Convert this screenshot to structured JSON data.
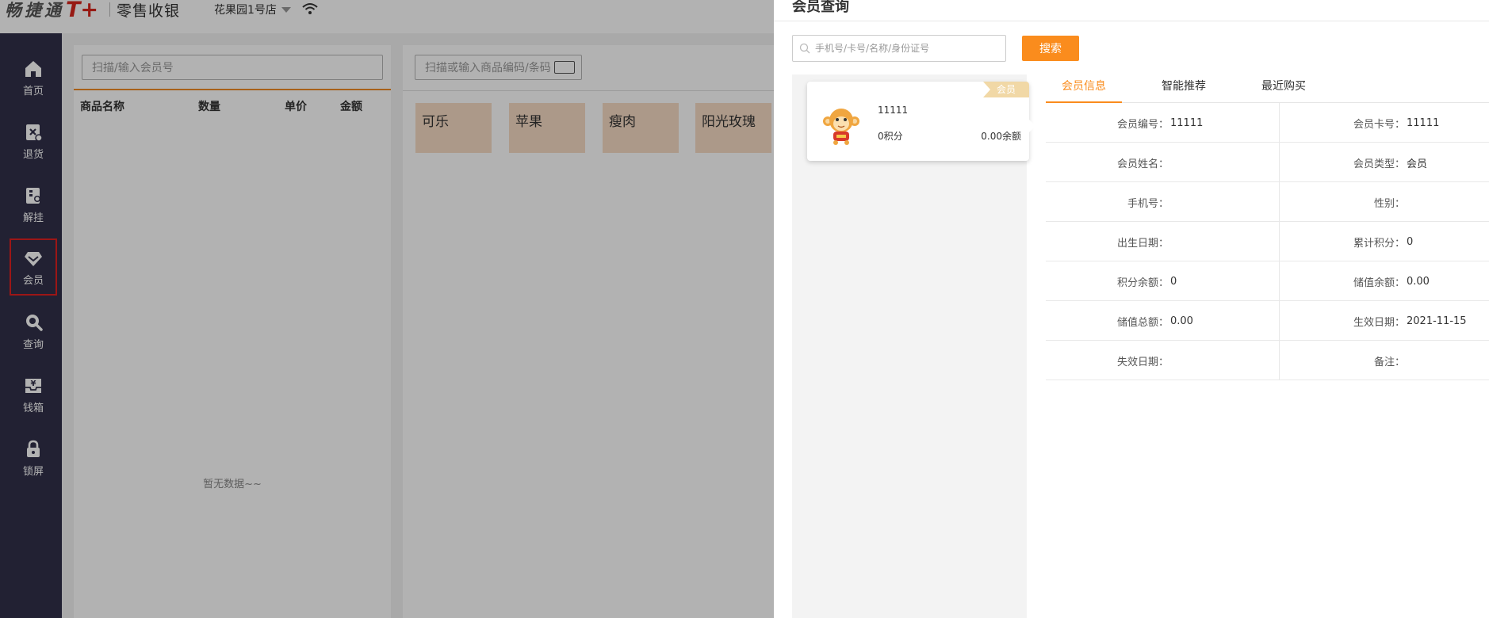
{
  "pos": {
    "logo_text": "畅捷通",
    "logo_mark": "T+",
    "app_name": "零售收银",
    "store_name": "花果园1号店",
    "nav": [
      {
        "label": "首页",
        "icon": "home-icon"
      },
      {
        "label": "退货",
        "icon": "return-icon"
      },
      {
        "label": "解挂",
        "icon": "unhold-icon"
      },
      {
        "label": "会员",
        "icon": "diamond-icon"
      },
      {
        "label": "查询",
        "icon": "search-icon"
      },
      {
        "label": "钱箱",
        "icon": "cash-box-icon"
      },
      {
        "label": "锁屏",
        "icon": "lock-icon"
      }
    ],
    "active_nav": "会员",
    "member_input_placeholder": "扫描/输入会员号",
    "cart_columns": [
      "商品名称",
      "数量",
      "单价",
      "金额"
    ],
    "empty_text": "暂无数据~~",
    "goods_input_placeholder": "扫描或输入商品编码/条码",
    "goods": [
      "可乐",
      "苹果",
      "瘦肉",
      "阳光玫瑰"
    ]
  },
  "drawer": {
    "title": "会员查询",
    "search_placeholder": "手机号/卡号/名称/身份证号",
    "search_label": "搜索",
    "card": {
      "tag": "会员",
      "name": "11111",
      "points": "0积分",
      "balance": "0.00余额"
    },
    "tabs": [
      "会员信息",
      "智能推荐",
      "最近购买"
    ],
    "active_tab": "会员信息",
    "fields": [
      [
        {
          "label": "会员编号：",
          "value": "11111"
        },
        {
          "label": "会员卡号：",
          "value": "11111"
        }
      ],
      [
        {
          "label": "会员姓名：",
          "value": ""
        },
        {
          "label": "会员类型：",
          "value": "会员"
        }
      ],
      [
        {
          "label": "手机号：",
          "value": ""
        },
        {
          "label": "性别：",
          "value": ""
        }
      ],
      [
        {
          "label": "出生日期：",
          "value": ""
        },
        {
          "label": "累计积分：",
          "value": "0"
        }
      ],
      [
        {
          "label": "积分余额：",
          "value": "0"
        },
        {
          "label": "储值余额：",
          "value": "0.00"
        }
      ],
      [
        {
          "label": "储值总额：",
          "value": "0.00"
        },
        {
          "label": "生效日期：",
          "value": "2021-11-15"
        }
      ],
      [
        {
          "label": "失效日期：",
          "value": ""
        },
        {
          "label": "备注：",
          "value": ""
        }
      ]
    ]
  },
  "colors": {
    "accent": "#fa8c1d",
    "sidebar": "#31304a",
    "active_outline": "#e02020",
    "tile": "#f7dcc5",
    "tag": "#f1d8a6"
  }
}
